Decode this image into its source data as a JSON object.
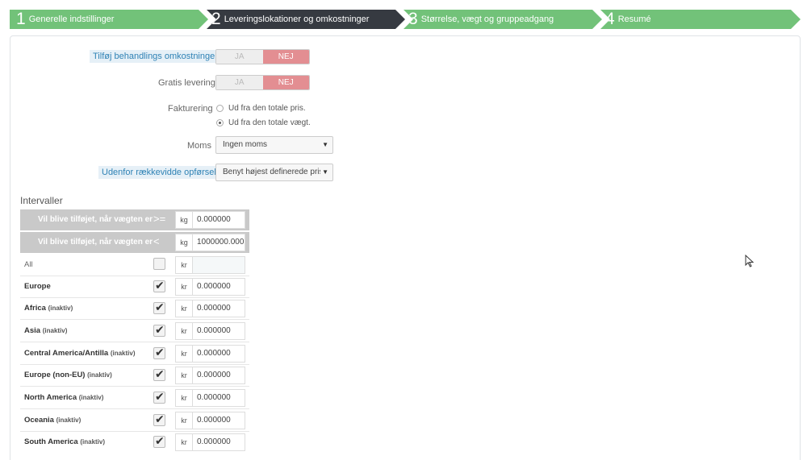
{
  "steps": [
    {
      "num": "1",
      "label": "Generelle indstillinger",
      "state": "done"
    },
    {
      "num": "2",
      "label": "Leveringslokationer og omkostninger",
      "state": "active"
    },
    {
      "num": "3",
      "label": "Størrelse, vægt og gruppeadgang",
      "state": "todo"
    },
    {
      "num": "4",
      "label": "Resumé",
      "state": "todo"
    }
  ],
  "form": {
    "handling": {
      "label": "Tilføj behandlings omkostninger",
      "yes": "JA",
      "no": "NEJ",
      "value": "NEJ"
    },
    "free_shipping": {
      "label": "Gratis levering",
      "yes": "JA",
      "no": "NEJ",
      "value": "NEJ"
    },
    "billing": {
      "label": "Fakturering",
      "options": [
        "Ud fra den totale pris.",
        "Ud fra den totale vægt."
      ],
      "selected": "Ud fra den totale vægt."
    },
    "tax": {
      "label": "Moms",
      "value": "Ingen moms"
    },
    "out_of_range": {
      "label": "Udenfor rækkevidde opførsel",
      "value": "Benyt højest definerede pris"
    }
  },
  "intervals": {
    "title": "Intervaller",
    "from": {
      "label": "Vil blive tilføjet, når vægten er",
      "op": ">=",
      "unit": "kg",
      "value": "0.000000"
    },
    "to": {
      "label": "Vil blive tilføjet, når vægten er",
      "op": "<",
      "unit": "kg",
      "value": "1000000.000"
    },
    "all": {
      "label": "All",
      "unit": "kr",
      "value": ""
    },
    "zones": [
      {
        "name": "Europe",
        "status": "",
        "unit": "kr",
        "value": "0.000000"
      },
      {
        "name": "Africa",
        "status": "(inaktiv)",
        "unit": "kr",
        "value": "0.000000"
      },
      {
        "name": "Asia",
        "status": "(inaktiv)",
        "unit": "kr",
        "value": "0.000000"
      },
      {
        "name": "Central America/Antilla",
        "status": "(inaktiv)",
        "unit": "kr",
        "value": "0.000000"
      },
      {
        "name": "Europe (non-EU)",
        "status": "(inaktiv)",
        "unit": "kr",
        "value": "0.000000"
      },
      {
        "name": "North America",
        "status": "(inaktiv)",
        "unit": "kr",
        "value": "0.000000"
      },
      {
        "name": "Oceania",
        "status": "(inaktiv)",
        "unit": "kr",
        "value": "0.000000"
      },
      {
        "name": "South America",
        "status": "(inaktiv)",
        "unit": "kr",
        "value": "0.000000"
      }
    ]
  },
  "colors": {
    "step_done": "#72c279",
    "step_active": "#363a41",
    "no_active": "#e38e92",
    "highlight_label": "#2f82b5"
  }
}
